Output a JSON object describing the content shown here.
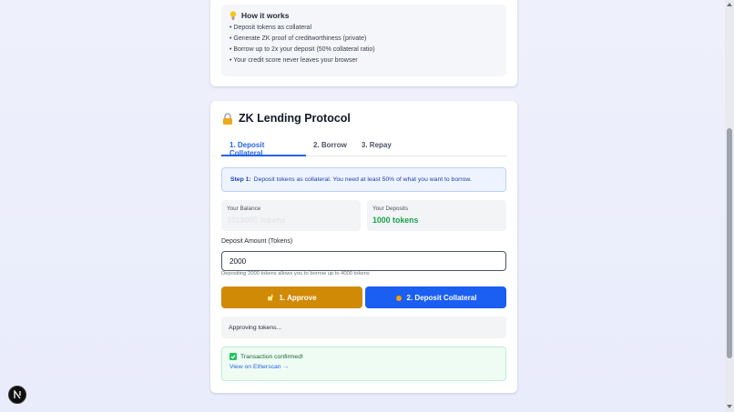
{
  "how_it_works": {
    "title": "How it works",
    "items": [
      "• Deposit tokens as collateral",
      "• Generate ZK proof of creditworthiness (private)",
      "• Borrow up to 2x your deposit (50% collateral ratio)",
      "• Your credit score never leaves your browser"
    ]
  },
  "protocol": {
    "title": "ZK Lending Protocol",
    "tabs": [
      {
        "label": "1. Deposit Collateral"
      },
      {
        "label": "2. Borrow"
      },
      {
        "label": "3. Repay"
      }
    ],
    "step": {
      "prefix": "Step 1:",
      "text": "Deposit tokens as collateral. You need at least 50% of what you want to borrow."
    },
    "balance": {
      "label": "Your Balance",
      "value": "1019000 tokens"
    },
    "deposits": {
      "label": "Your Deposits",
      "value": "1000 tokens"
    },
    "amount": {
      "label": "Deposit Amount (Tokens)",
      "value": "2000",
      "hint": "Depositing 2000 tokens allows you to borrow up to 4000 tokens"
    },
    "buttons": {
      "approve": "1. Approve",
      "deposit": "2. Deposit Collateral"
    },
    "status": "Approving tokens...",
    "success": {
      "message": "Transaction confirmed!",
      "link": "View on Etherscan →"
    }
  },
  "icons": {
    "bulb": "lightbulb-icon",
    "lock": "lock-icon",
    "approve": "hand-icon",
    "deposit": "money-bag-icon",
    "check": "check-icon"
  },
  "colors": {
    "accent": "#2563eb",
    "approve": "#d08a06",
    "deposit": "#1a5ef2",
    "success": "#16a34a"
  }
}
